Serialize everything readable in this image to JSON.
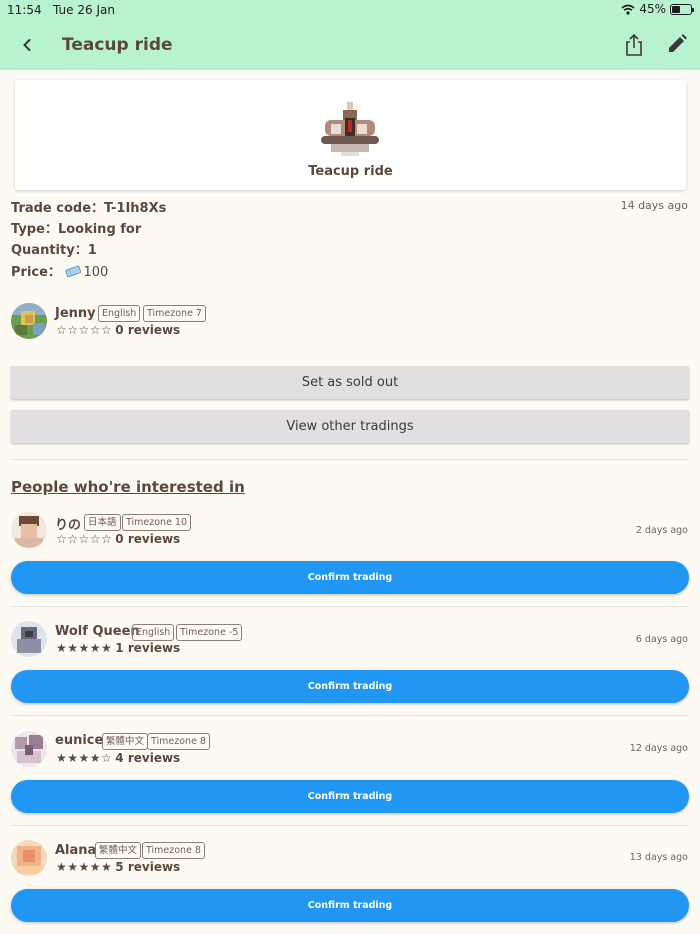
{
  "status_bar": {
    "time": "11:54",
    "date": "Tue 26 Jan",
    "battery": "45%",
    "battery_level": 0.45
  },
  "header": {
    "title": "Teacup ride"
  },
  "item": {
    "name": "Teacup ride"
  },
  "trade": {
    "code_label": "Trade code：",
    "code": "T-1Ih8Xs",
    "date": "14 days ago",
    "type_label": "Type：",
    "type": "Looking for",
    "quantity_label": "Quantity：",
    "quantity": "1",
    "price_label": "Price：",
    "price": "100"
  },
  "owner": {
    "name": "Jenny",
    "language": "English",
    "timezone": "Timezone 7",
    "stars": "☆☆☆☆☆",
    "reviews": "0 reviews"
  },
  "actions": {
    "sold_out": "Set as sold out",
    "view_other": "View other tradings"
  },
  "interested": {
    "heading": "People who're interested in",
    "confirm_label": "Confirm trading",
    "people": [
      {
        "name": "りの",
        "language": "日本語",
        "timezone": "Timezone 10",
        "stars": "☆☆☆☆☆",
        "reviews": "0 reviews",
        "date": "2 days ago"
      },
      {
        "name": "Wolf Queen",
        "language": "English",
        "timezone": "Timezone -5",
        "stars": "★★★★★",
        "reviews": "1 reviews",
        "date": "6 days ago"
      },
      {
        "name": "eunice",
        "language": "繁體中文",
        "timezone": "Timezone 8",
        "stars": "★★★★☆",
        "reviews": "4 reviews",
        "date": "12 days ago"
      },
      {
        "name": "Alana",
        "language": "繁體中文",
        "timezone": "Timezone 8",
        "stars": "★★★★★",
        "reviews": "5 reviews",
        "date": "13 days ago"
      }
    ]
  },
  "colors": {
    "header": "#b8f2cf",
    "background": "#fdf9f3",
    "text": "#5b4a3c",
    "accent_button": "#2196f3",
    "gray_button": "#e0e0e0"
  },
  "icons": {
    "back": "chevron-left-icon",
    "share": "share-icon",
    "edit": "pencil-icon",
    "ticket": "ticket-icon",
    "wifi": "wifi-icon",
    "battery": "battery-icon"
  }
}
